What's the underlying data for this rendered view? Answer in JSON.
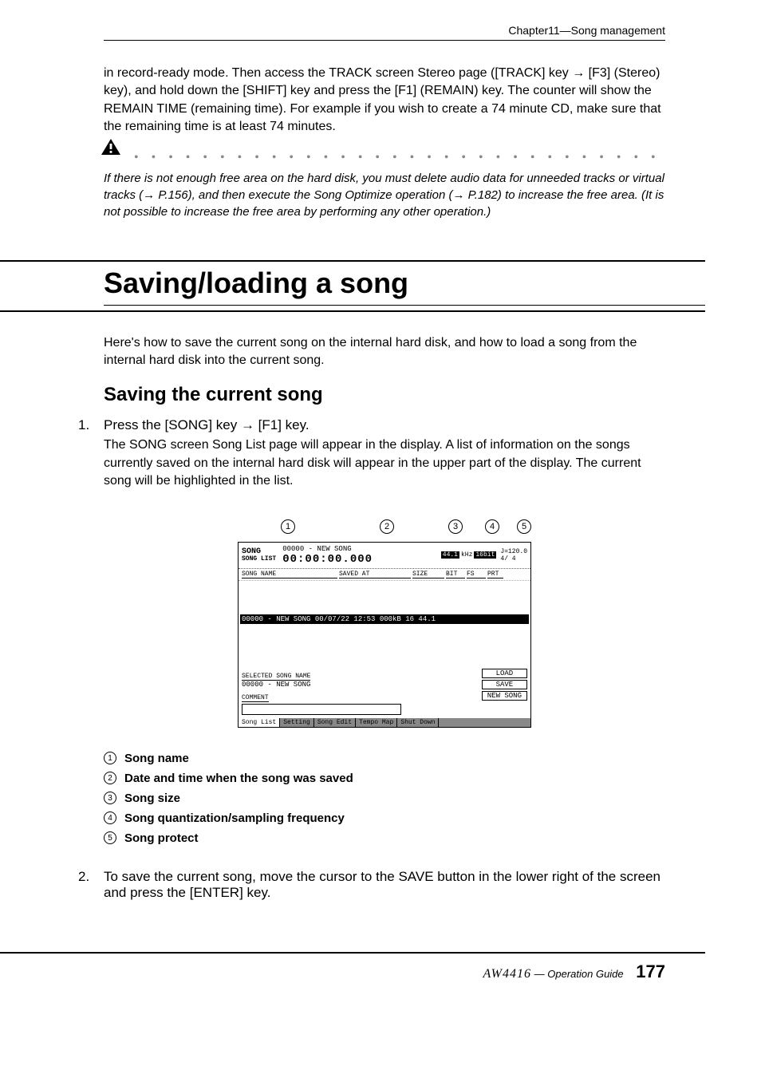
{
  "header": {
    "chapter": "Chapter11—Song management"
  },
  "intro_para": "in record-ready mode. Then access the TRACK screen Stereo page ([TRACK] key → [F3] (Stereo) key), and hold down the [SHIFT] key and press the [F1] (REMAIN) key. The counter will show the REMAIN TIME (remaining time). For example if you wish to create a 74 minute CD, make sure that the remaining time is at least 74 minutes.",
  "note": "If there is not enough free area on the hard disk, you must delete audio data for unneeded tracks or virtual tracks (→ P.156), and then execute the Song Optimize operation (→ P.182) to increase the free area. (It is not possible to increase the free area by performing any other operation.)",
  "section_title": "Saving/loading a song",
  "section_intro": "Here's how to save the current song on the internal hard disk, and how to load a song from the internal hard disk into the current song.",
  "sub_heading": "Saving the current song",
  "step1": {
    "num": "1.",
    "heading": "Press the [SONG] key → [F1] key.",
    "text": "The SONG screen Song List page will appear in the display. A list of information on the songs currently saved on the internal hard disk will appear in the upper part of the display. The current song will be highlighted in the list."
  },
  "lcd": {
    "title_main": "SONG",
    "title_sub": "SONG LIST",
    "song_info": "00000 - NEW SONG",
    "timecode": "00:00:00.000",
    "rate": "44.1",
    "rate_unit": "kHz",
    "bit": "16bit",
    "tempo": "J=120.0",
    "sig": "4/ 4",
    "col_name": "SONG NAME",
    "col_saved": "SAVED AT",
    "col_size": "SIZE",
    "col_bit": "BIT",
    "col_fs": "FS",
    "col_prt": "PRT",
    "row_selected": "00000 - NEW SONG   00/07/22 12:53   000kB 16 44.1",
    "sel_label": "SELECTED SONG NAME",
    "sel_value": "00000 - NEW SONG",
    "comment_label": "COMMENT",
    "btn_load": "LOAD",
    "btn_save": "SAVE",
    "btn_new": "NEW SONG",
    "tabs": [
      "Song List",
      "Setting",
      "Song Edit",
      "Tempo Map",
      "Shut Down"
    ]
  },
  "callouts": {
    "c1": "1",
    "c2": "2",
    "c3": "3",
    "c4": "4",
    "c5": "5"
  },
  "legend": [
    {
      "num": "1",
      "label": "Song name"
    },
    {
      "num": "2",
      "label": "Date and time when the song was saved"
    },
    {
      "num": "3",
      "label": "Song size"
    },
    {
      "num": "4",
      "label": "Song quantization/sampling frequency"
    },
    {
      "num": "5",
      "label": "Song protect"
    }
  ],
  "step2": {
    "num": "2.",
    "heading": "To save the current song, move the cursor to the SAVE button in the lower right of the screen and press the [ENTER] key."
  },
  "footer": {
    "model": "AW4416",
    "guide": "— Operation Guide",
    "page": "177"
  }
}
